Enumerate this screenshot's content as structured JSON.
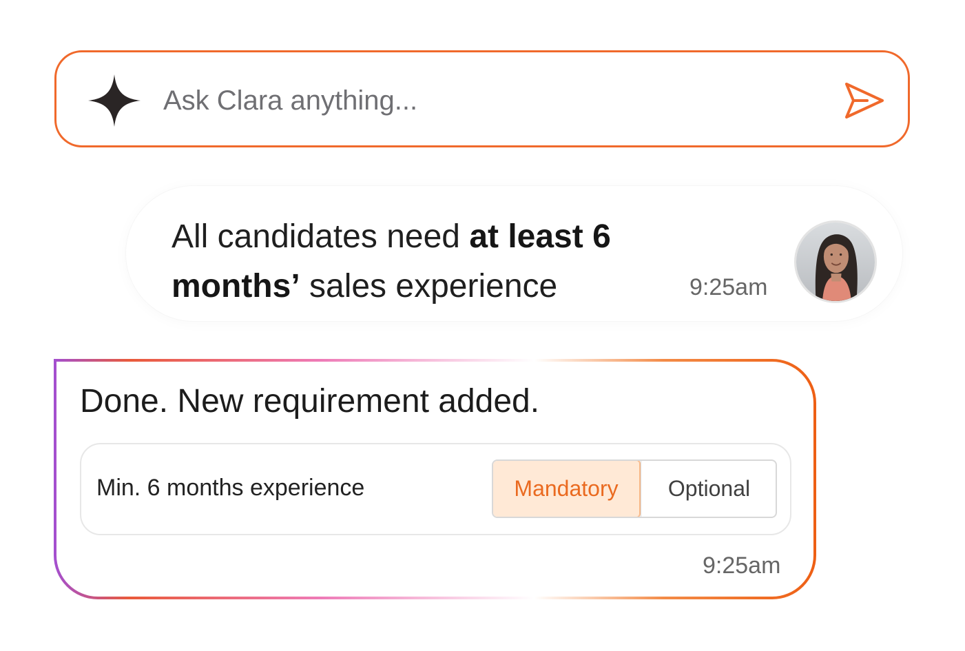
{
  "prompt": {
    "placeholder": "Ask Clara anything...",
    "value": "",
    "leading_icon": "sparkle-icon",
    "send_icon": "send-icon",
    "accent_color": "#f0692b"
  },
  "user_message": {
    "text_before": "All candidates need ",
    "text_bold": "at least 6 months’",
    "text_after": " sales experience",
    "time": "9:25am",
    "avatar": "user-avatar"
  },
  "assistant_message": {
    "text": "Done. New requirement added.",
    "requirement": {
      "label": "Min. 6 months experience",
      "options": [
        "Mandatory",
        "Optional"
      ],
      "selected": "Mandatory"
    },
    "time": "9:25am"
  }
}
